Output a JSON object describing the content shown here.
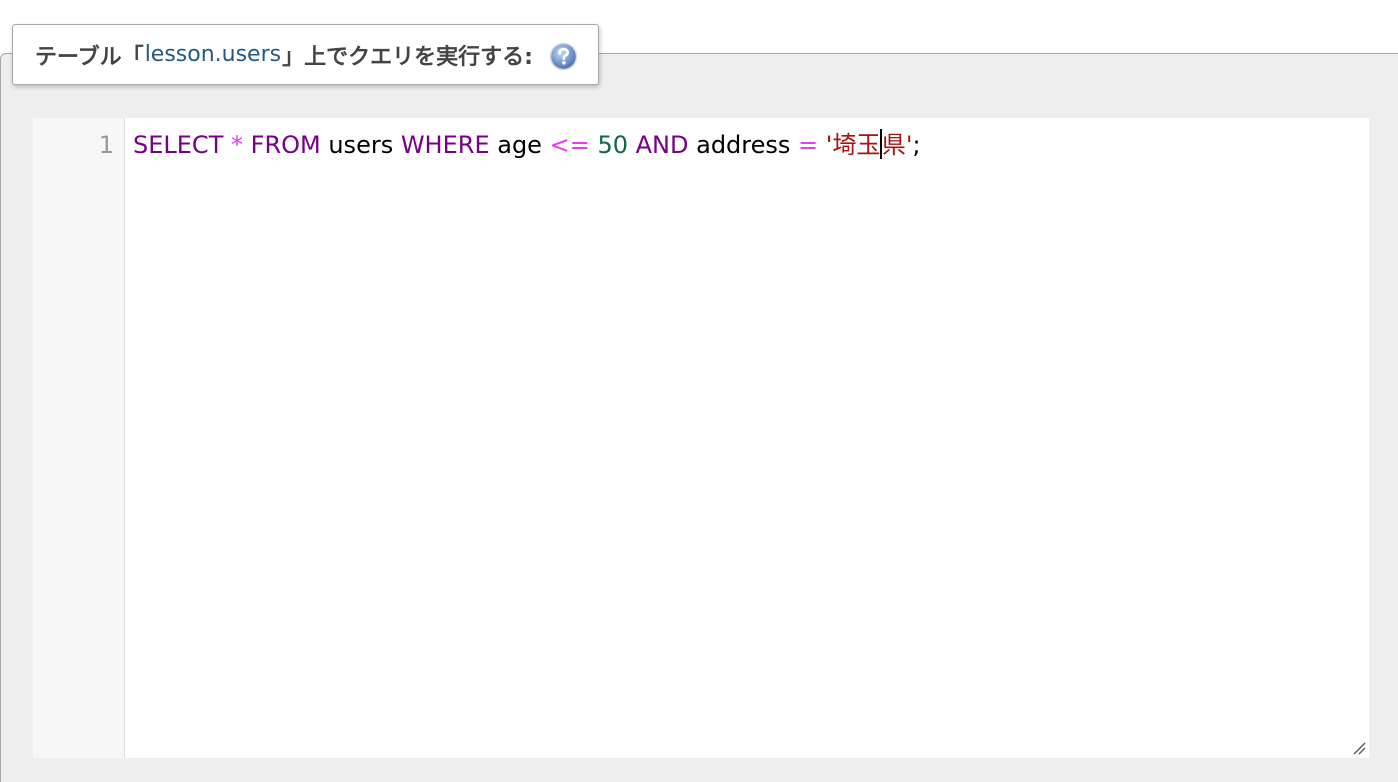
{
  "query_box": {
    "legend_prefix": "テーブル「",
    "table_name": "lesson.users",
    "legend_suffix": "」上でクエリを実行する:",
    "help_icon": "help-question-icon"
  },
  "editor": {
    "line_numbers": [
      "1"
    ],
    "code_tokens": [
      {
        "text": "SELECT",
        "type": "keyword"
      },
      {
        "text": " ",
        "type": "space"
      },
      {
        "text": "*",
        "type": "operator"
      },
      {
        "text": " ",
        "type": "space"
      },
      {
        "text": "FROM",
        "type": "keyword"
      },
      {
        "text": " users ",
        "type": "identifier"
      },
      {
        "text": "WHERE",
        "type": "keyword"
      },
      {
        "text": " age ",
        "type": "identifier"
      },
      {
        "text": "<=",
        "type": "operator"
      },
      {
        "text": " ",
        "type": "space"
      },
      {
        "text": "50",
        "type": "number"
      },
      {
        "text": " ",
        "type": "space"
      },
      {
        "text": "AND",
        "type": "keyword"
      },
      {
        "text": " address ",
        "type": "identifier"
      },
      {
        "text": "=",
        "type": "operator"
      },
      {
        "text": " ",
        "type": "space"
      },
      {
        "text": "'埼玉",
        "type": "string"
      },
      {
        "text": "県'",
        "type": "string"
      },
      {
        "text": ";",
        "type": "punctuation"
      }
    ],
    "colors": {
      "keyword": "#770088",
      "operator": "#e63cf5",
      "number": "#116644",
      "string": "#aa1111",
      "identifier": "#000000"
    }
  }
}
